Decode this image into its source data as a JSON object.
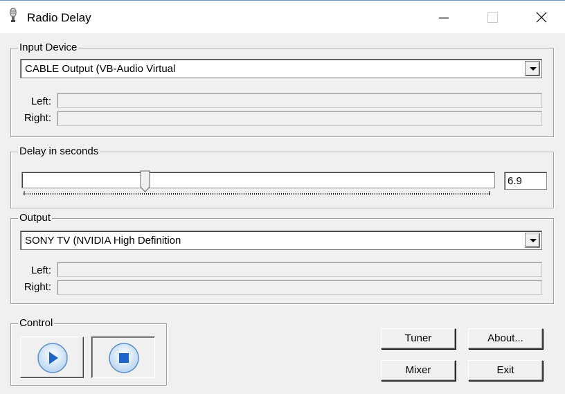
{
  "window": {
    "title": "Radio Delay",
    "app_icon": "microphone-icon",
    "controls": [
      "minimize-icon",
      "maximize-icon",
      "close-icon"
    ]
  },
  "input_device": {
    "group_label": "Input Device",
    "selected": "CABLE Output (VB-Audio Virtual",
    "left_label": "Left:",
    "right_label": "Right:",
    "left_level": 0,
    "right_level": 0
  },
  "delay": {
    "group_label": "Delay in seconds",
    "value": "6.9"
  },
  "output": {
    "group_label": "Output",
    "selected": "SONY TV (NVIDIA High Definition",
    "left_label": "Left:",
    "right_label": "Right:",
    "left_level": 0,
    "right_level": 0
  },
  "control": {
    "group_label": "Control",
    "play_icon": "play-icon",
    "stop_icon": "stop-icon",
    "stop_pressed": true
  },
  "buttons": {
    "tuner": "Tuner",
    "about": "About...",
    "mixer": "Mixer",
    "exit": "Exit"
  },
  "colors": {
    "accent_blue": "#1e64c8",
    "window_bg": "#f0f0f0"
  }
}
